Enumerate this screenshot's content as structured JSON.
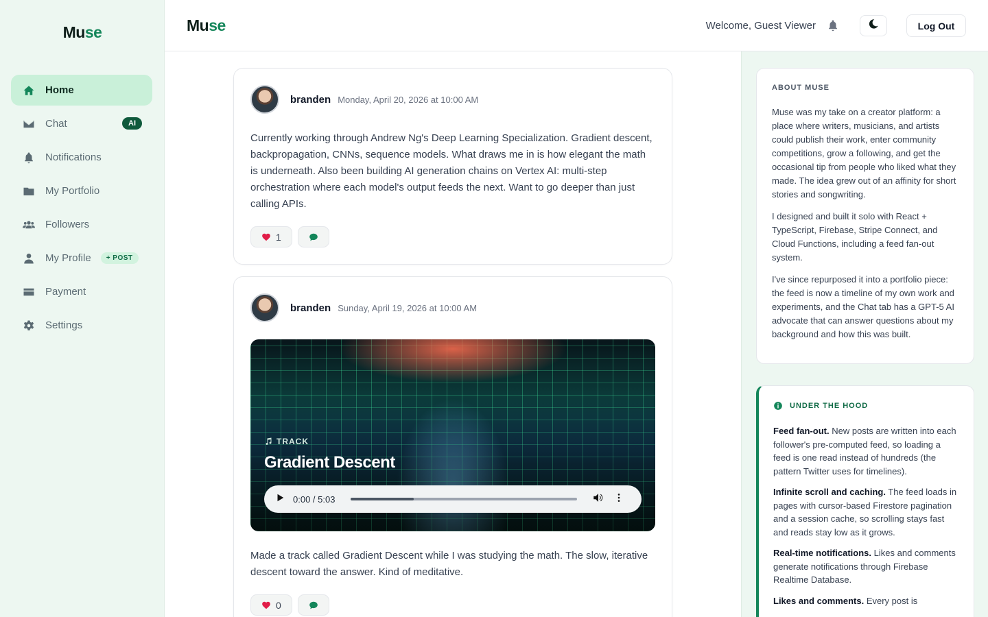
{
  "app": {
    "logo_mu": "Mu",
    "logo_se": "se"
  },
  "sidebar": {
    "items": [
      {
        "label": "Home",
        "icon": "home-icon",
        "active": true
      },
      {
        "label": "Chat",
        "icon": "envelope-icon",
        "badge": "AI"
      },
      {
        "label": "Notifications",
        "icon": "bell-icon"
      },
      {
        "label": "My Portfolio",
        "icon": "folder-icon"
      },
      {
        "label": "Followers",
        "icon": "users-icon"
      },
      {
        "label": "My Profile",
        "icon": "user-icon",
        "badge": "+ POST"
      },
      {
        "label": "Payment",
        "icon": "credit-card-icon"
      },
      {
        "label": "Settings",
        "icon": "gear-icon"
      }
    ]
  },
  "header": {
    "welcome": "Welcome, Guest Viewer",
    "logout_label": "Log Out"
  },
  "posts": [
    {
      "author": "branden",
      "date": "Monday, April 20, 2026 at 10:00 AM",
      "text": "Currently working through Andrew Ng's Deep Learning Specialization. Gradient descent, backpropagation, CNNs, sequence models. What draws me in is how elegant the math is underneath. Also been building AI generation chains on Vertex AI: multi-step orchestration where each model's output feeds the next. Want to go deeper than just calling APIs.",
      "likes": "1"
    },
    {
      "author": "branden",
      "date": "Sunday, April 19, 2026 at 10:00 AM",
      "track_label": "TRACK",
      "track_title": "Gradient Descent",
      "player_time": "0:00 / 5:03",
      "player_progress": 0.28,
      "text": "Made a track called Gradient Descent while I was studying the math. The slow, iterative descent toward the answer. Kind of meditative.",
      "likes": "0"
    }
  ],
  "about": {
    "title": "ABOUT MUSE",
    "p1": "Muse was my take on a creator platform: a place where writers, musicians, and artists could publish their work, enter community competitions, grow a following, and get the occasional tip from people who liked what they made. The idea grew out of an affinity for short stories and songwriting.",
    "p2": "I designed and built it solo with React + TypeScript, Firebase, Stripe Connect, and Cloud Functions, including a feed fan-out system.",
    "p3": "I've since repurposed it into a portfolio piece: the feed is now a timeline of my own work and experiments, and the Chat tab has a GPT-5 AI advocate that can answer questions about my background and how this was built."
  },
  "hood": {
    "title": "UNDER THE HOOD",
    "items": [
      {
        "head": "Feed fan-out.",
        "body": " New posts are written into each follower's pre-computed feed, so loading a feed is one read instead of hundreds (the pattern Twitter uses for timelines)."
      },
      {
        "head": "Infinite scroll and caching.",
        "body": " The feed loads in pages with cursor-based Firestore pagination and a session cache, so scrolling stays fast and reads stay low as it grows."
      },
      {
        "head": "Real-time notifications.",
        "body": " Likes and comments generate notifications through Firebase Realtime Database."
      },
      {
        "head": "Likes and comments.",
        "body": " Every post is"
      }
    ]
  }
}
